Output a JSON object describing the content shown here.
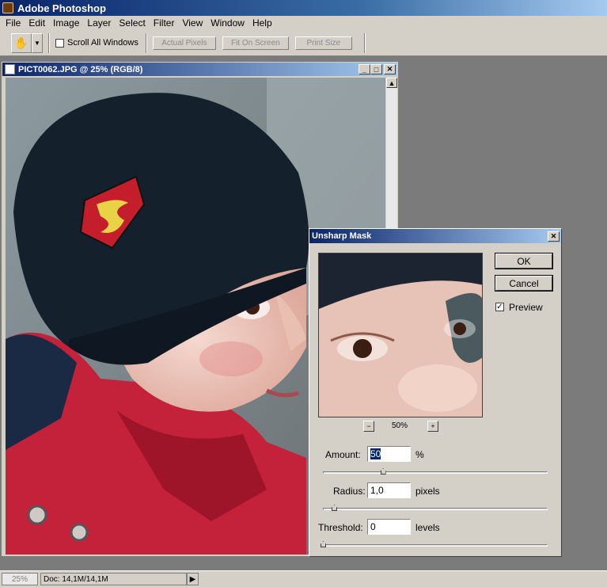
{
  "app": {
    "title": "Adobe Photoshop"
  },
  "menu": [
    "File",
    "Edit",
    "Image",
    "Layer",
    "Select",
    "Filter",
    "View",
    "Window",
    "Help"
  ],
  "options": {
    "scroll_all_label": "Scroll All Windows",
    "buttons": [
      "Actual Pixels",
      "Fit On Screen",
      "Print Size"
    ]
  },
  "document": {
    "title": "PICT0062.JPG @ 25% (RGB/8)"
  },
  "dialog": {
    "title": "Unsharp Mask",
    "ok": "OK",
    "cancel": "Cancel",
    "preview_label": "Preview",
    "preview_checked": true,
    "zoom": "50%",
    "zoom_out": "−",
    "zoom_in": "+",
    "amount_label": "Amount:",
    "amount_value": "50",
    "amount_unit": "%",
    "amount_fraction": 0.27,
    "radius_label": "Radius:",
    "radius_value": "1,0",
    "radius_unit": "pixels",
    "radius_fraction": 0.05,
    "threshold_label": "Threshold:",
    "threshold_value": "0",
    "threshold_unit": "levels",
    "threshold_fraction": 0.0
  },
  "status": {
    "zoom": "25%",
    "doc": "Doc: 14,1M/14,1M"
  },
  "colors": {
    "title_dark": "#0a246a",
    "title_light": "#a6caf0",
    "face": "#d4d0c8",
    "workspace": "#7b7b7b"
  },
  "icons": [
    "hand-tool-icon",
    "photoshop-app-icon",
    "document-icon",
    "minimize-icon",
    "maximize-icon",
    "close-icon",
    "checkmark-icon",
    "play-arrow-icon"
  ]
}
